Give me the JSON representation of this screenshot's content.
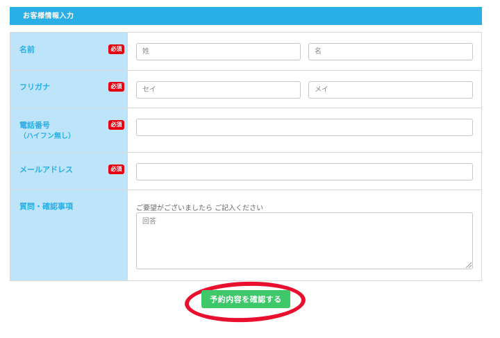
{
  "header": {
    "title": "お客様情報入力"
  },
  "rows": {
    "name": {
      "label": "名前",
      "required": "必須",
      "last_placeholder": "姓",
      "first_placeholder": "名"
    },
    "kana": {
      "label": "フリガナ",
      "required": "必須",
      "last_placeholder": "セイ",
      "first_placeholder": "メイ"
    },
    "phone": {
      "label": "電話番号",
      "sublabel": "（ハイフン無し）",
      "required": "必須",
      "value": ""
    },
    "email": {
      "label": "メールアドレス",
      "required": "必須",
      "value": ""
    },
    "question": {
      "label": "質問・確認事項",
      "note": "ご要望がございましたら ご記入ください",
      "placeholder": "回答"
    }
  },
  "submit": {
    "label": "予約内容を確認する"
  },
  "colors": {
    "header_bg": "#29aee6",
    "label_bg": "#bde4f8",
    "label_text": "#29aee6",
    "required_badge": "#e60012",
    "submit_bg": "#3ec86a",
    "highlight_ring": "#e8102e"
  }
}
